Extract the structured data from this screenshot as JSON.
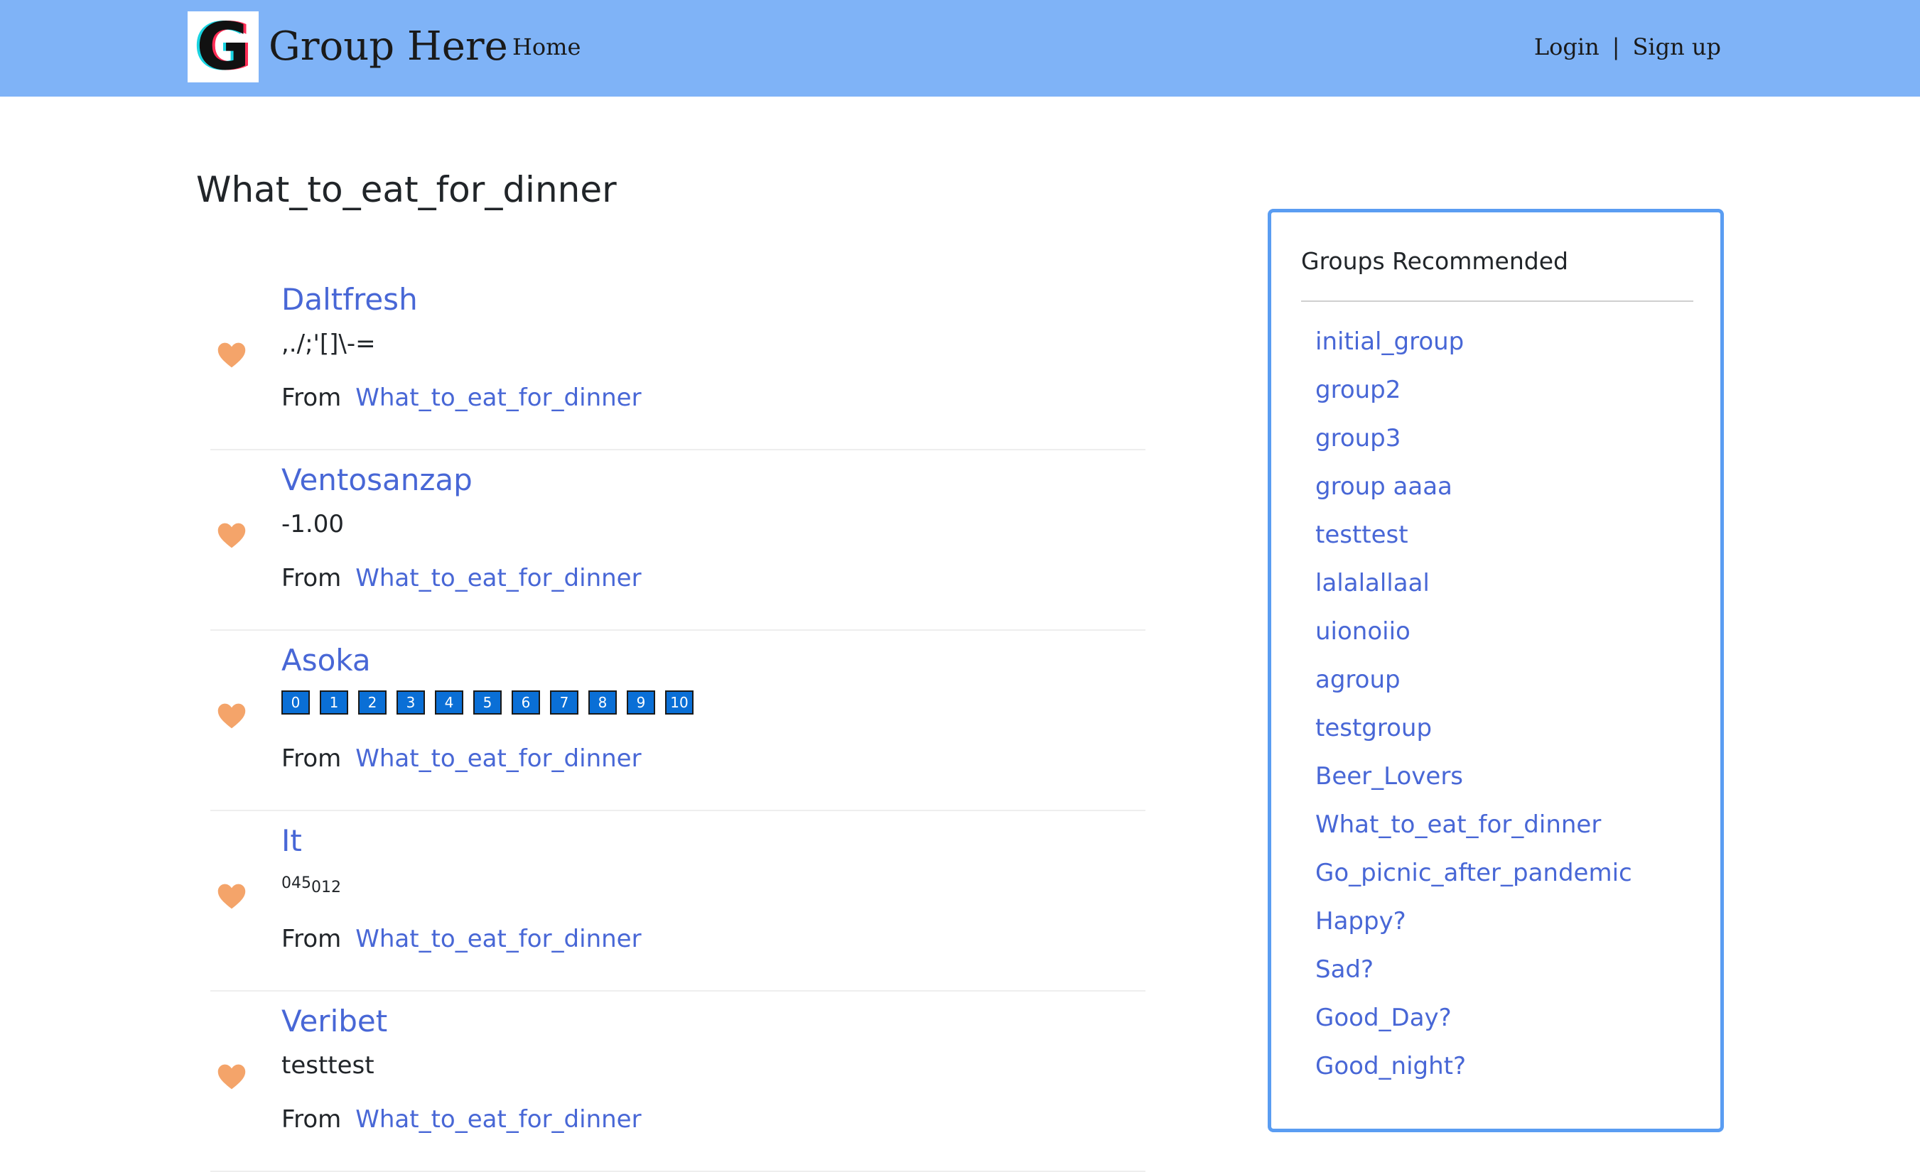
{
  "navbar": {
    "logo_letter": "G",
    "brand": "Group Here",
    "home": "Home",
    "login": "Login",
    "separator": "|",
    "signup": "Sign up"
  },
  "page_title": "What_to_eat_for_dinner",
  "colors": {
    "navbar_bg": "#7fb3f7",
    "link": "#4867d6",
    "heart": "#f4a46a",
    "sidebar_border": "#5a9df2",
    "number_box": "#0a6fd6"
  },
  "posts": [
    {
      "title": "Daltfresh",
      "body": ",./;'[]\\-=",
      "from_label": "From",
      "group": "What_to_eat_for_dinner"
    },
    {
      "title": "Ventosanzap",
      "body": "-1.00",
      "from_label": "From",
      "group": "What_to_eat_for_dinner"
    },
    {
      "title": "Asoka",
      "numbers": [
        "0",
        "1",
        "2",
        "3",
        "4",
        "5",
        "6",
        "7",
        "8",
        "9",
        "10"
      ],
      "from_label": "From",
      "group": "What_to_eat_for_dinner"
    },
    {
      "title": "It",
      "body_sup": "045",
      "body_sub": "012",
      "from_label": "From",
      "group": "What_to_eat_for_dinner"
    },
    {
      "title": "Veribet",
      "body": "testtest",
      "from_label": "From",
      "group": "What_to_eat_for_dinner"
    }
  ],
  "sidebar": {
    "title": "Groups Recommended",
    "groups": [
      "initial_group",
      "group2",
      "group3",
      "group aaaa",
      "testtest",
      "lalalallaal",
      "uionoiio",
      "agroup",
      "testgroup",
      "Beer_Lovers",
      "What_to_eat_for_dinner",
      "Go_picnic_after_pandemic",
      "Happy?",
      "Sad?",
      "Good_Day?",
      "Good_night?"
    ]
  }
}
